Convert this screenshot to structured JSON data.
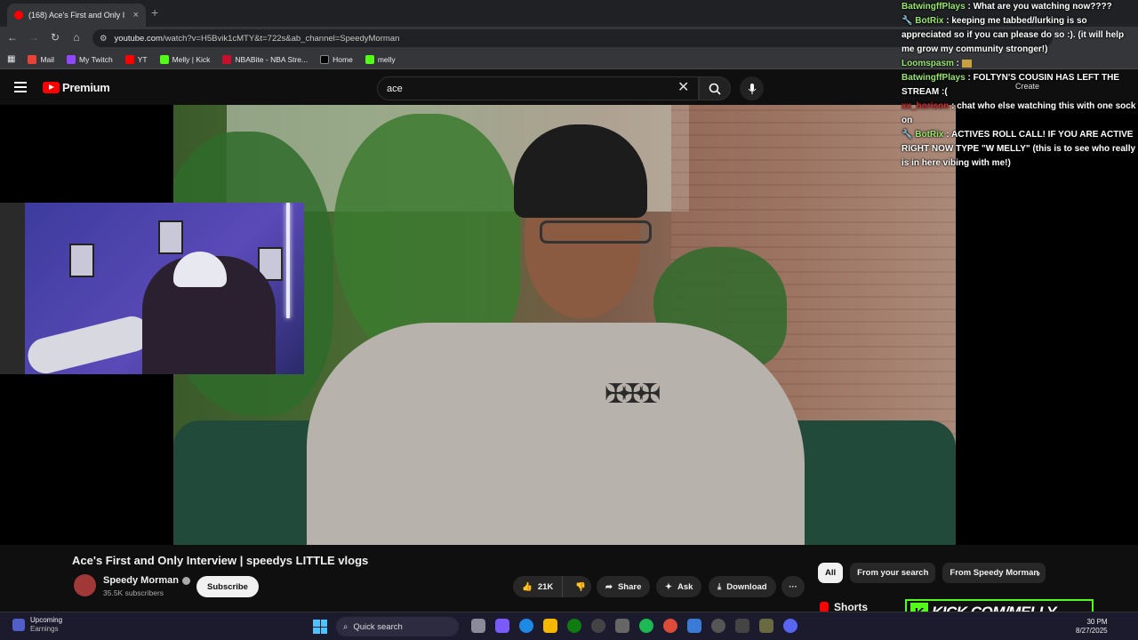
{
  "browser": {
    "tab_title": "(168) Ace's First and Only I",
    "tab_close": "×",
    "new_tab": "+",
    "url_host": "youtube.com",
    "url_path": "/watch?v=H5Bvik1cMTY&t=722s&ab_channel=SpeedyMorman",
    "bookmarks": [
      "Mail",
      "My Twitch",
      "YT",
      "Melly | Kick",
      "NBABite - NBA Stre...",
      "Home",
      "melly"
    ]
  },
  "youtube": {
    "logo_text": "Premium",
    "search_value": "ace",
    "video_title": "Ace's First and Only Interview | speedys LITTLE vlogs",
    "channel_name": "Speedy Morman",
    "subscribers": "35.5K subscribers",
    "subscribe_label": "Subscribe",
    "likes": "21K",
    "share_label": "Share",
    "ask_label": "Ask",
    "download_label": "Download",
    "more_label": "···",
    "chips": [
      "All",
      "From your search",
      "From Speedy Morman"
    ],
    "shorts_label": "Shorts",
    "create_label": "Create"
  },
  "chat": [
    {
      "user": "BatwingffPlays",
      "text": "What are you watching now????",
      "style": "green"
    },
    {
      "user": "BotRix",
      "text": "keeping me tabbed/lurking is so appreciated so if you can please do so :). (it will help me grow my community stronger!)",
      "style": "green",
      "bot": true
    },
    {
      "user": "Loomspasm",
      "text": "",
      "style": "green"
    },
    {
      "user": "BatwingffPlays",
      "text": "FOLTYN'S COUSIN HAS LEFT THE STREAM :(",
      "style": "green"
    },
    {
      "user": "xx_horison",
      "text": "chat who else watching this with one sock on",
      "style": "red"
    },
    {
      "user": "BotRix",
      "text": "ACTIVES ROLL CALL! IF YOU ARE ACTIVE RIGHT NOW TYPE \"W MELLY\" (this is to see who really is in here vibing with me!)",
      "style": "green",
      "bot": true
    }
  ],
  "overlay": {
    "kick_text": "KICK.COM/MELLY",
    "kick_letter": "K"
  },
  "taskbar": {
    "widget_title": "Upcoming",
    "widget_sub": "Earnings",
    "search_placeholder": "Quick search",
    "time": "30 PM",
    "date": "8/27/2025"
  }
}
